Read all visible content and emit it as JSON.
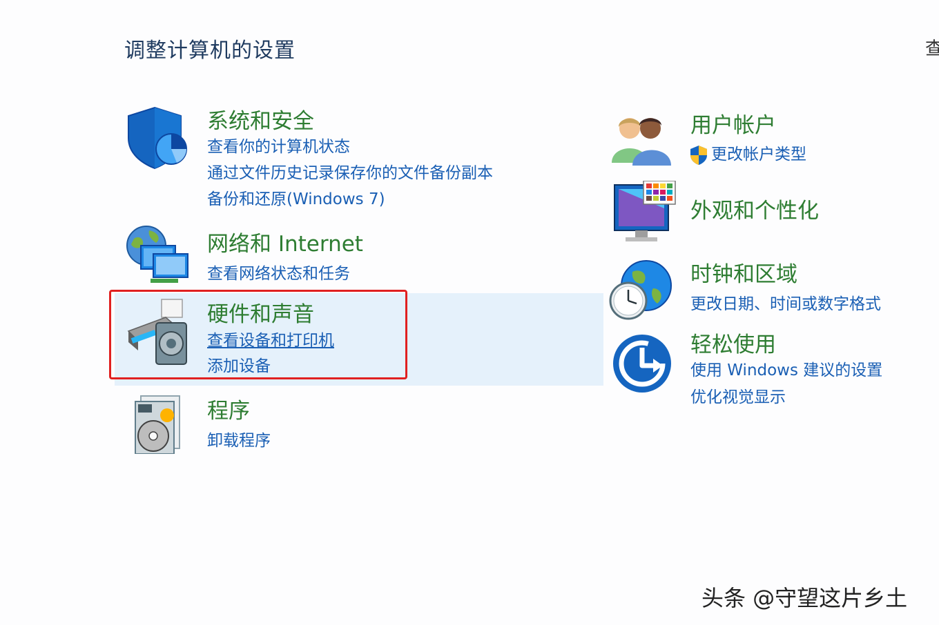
{
  "page": {
    "title": "调整计算机的设置",
    "view_by_label": "查"
  },
  "categories": {
    "system_security": {
      "title": "系统和安全",
      "links": [
        "查看你的计算机状态",
        "通过文件历史记录保存你的文件备份副本",
        "备份和还原(Windows 7)"
      ]
    },
    "network": {
      "title": "网络和 Internet",
      "links": [
        "查看网络状态和任务"
      ]
    },
    "hardware_sound": {
      "title": "硬件和声音",
      "links": [
        "查看设备和打印机",
        "添加设备"
      ]
    },
    "programs": {
      "title": "程序",
      "links": [
        "卸载程序"
      ]
    },
    "user_accounts": {
      "title": "用户帐户",
      "links": [
        "更改帐户类型"
      ]
    },
    "appearance": {
      "title": "外观和个性化",
      "links": []
    },
    "clock_region": {
      "title": "时钟和区域",
      "links": [
        "更改日期、时间或数字格式"
      ]
    },
    "ease_of_access": {
      "title": "轻松使用",
      "links": [
        "使用 Windows 建议的设置",
        "优化视觉显示"
      ]
    }
  },
  "watermark": "头条 @守望这片乡土",
  "colors": {
    "title_green": "#2e7d32",
    "link_blue": "#1a5fb4",
    "highlight_bg": "#e5f1fb",
    "annotation_red": "#e02020"
  }
}
